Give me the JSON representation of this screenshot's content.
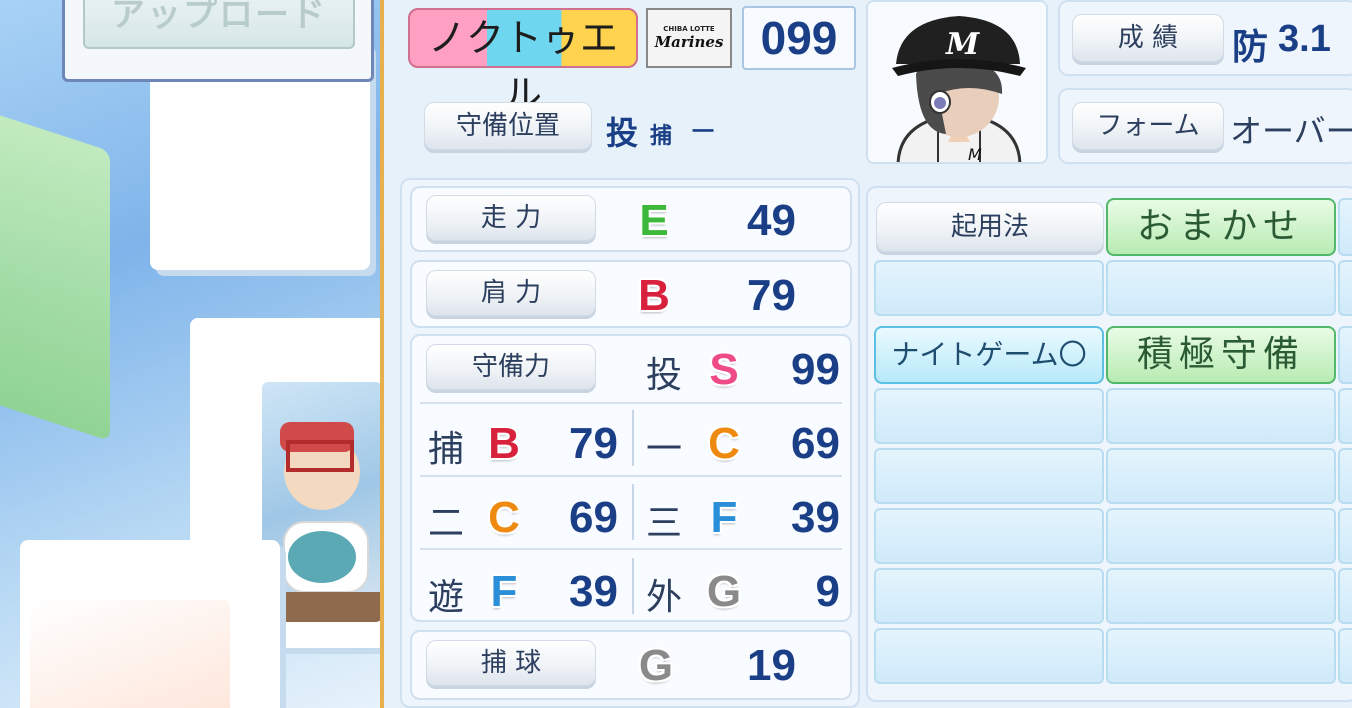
{
  "background": {
    "upload_label": "アップロード"
  },
  "player": {
    "name": "ノクトゥエル",
    "team_logo_small": "CHIBA LOTTE",
    "team_logo": "Marines",
    "uniform_number": "099"
  },
  "position_row": {
    "label": "守備位置",
    "primary": "投",
    "secondary": "捕",
    "tertiary": "一"
  },
  "record": {
    "label": "成 績",
    "stat_prefix": "防",
    "stat_value": "3.1"
  },
  "form": {
    "label": "フォーム",
    "value": "オーバース"
  },
  "stats": {
    "speed": {
      "label": "走 力",
      "grade": "E",
      "value": "49"
    },
    "arm": {
      "label": "肩 力",
      "grade": "B",
      "value": "79"
    },
    "defense": {
      "label": "守備力",
      "pitcher": {
        "pos": "投",
        "grade": "S",
        "value": "99"
      },
      "catcher": {
        "pos": "捕",
        "grade": "B",
        "value": "79"
      },
      "first": {
        "pos": "一",
        "grade": "C",
        "value": "69"
      },
      "second": {
        "pos": "二",
        "grade": "C",
        "value": "69"
      },
      "third": {
        "pos": "三",
        "grade": "F",
        "value": "39"
      },
      "short": {
        "pos": "遊",
        "grade": "F",
        "value": "39"
      },
      "outfield": {
        "pos": "外",
        "grade": "G",
        "value": "9"
      }
    },
    "catching": {
      "label": "捕 球",
      "grade": "G",
      "value": "19"
    }
  },
  "grade_colors": {
    "S": "#ee4c86",
    "A": "#e04a4a",
    "B": "#d8213c",
    "C": "#ef8a10",
    "D": "#e6c000",
    "E": "#3cb83a",
    "F": "#2a8fd8",
    "G": "#8a8a8a"
  },
  "abilities": {
    "usage_label": "起用法",
    "items": [
      "おまかせ",
      "ナイトゲーム〇",
      "積極守備"
    ]
  }
}
